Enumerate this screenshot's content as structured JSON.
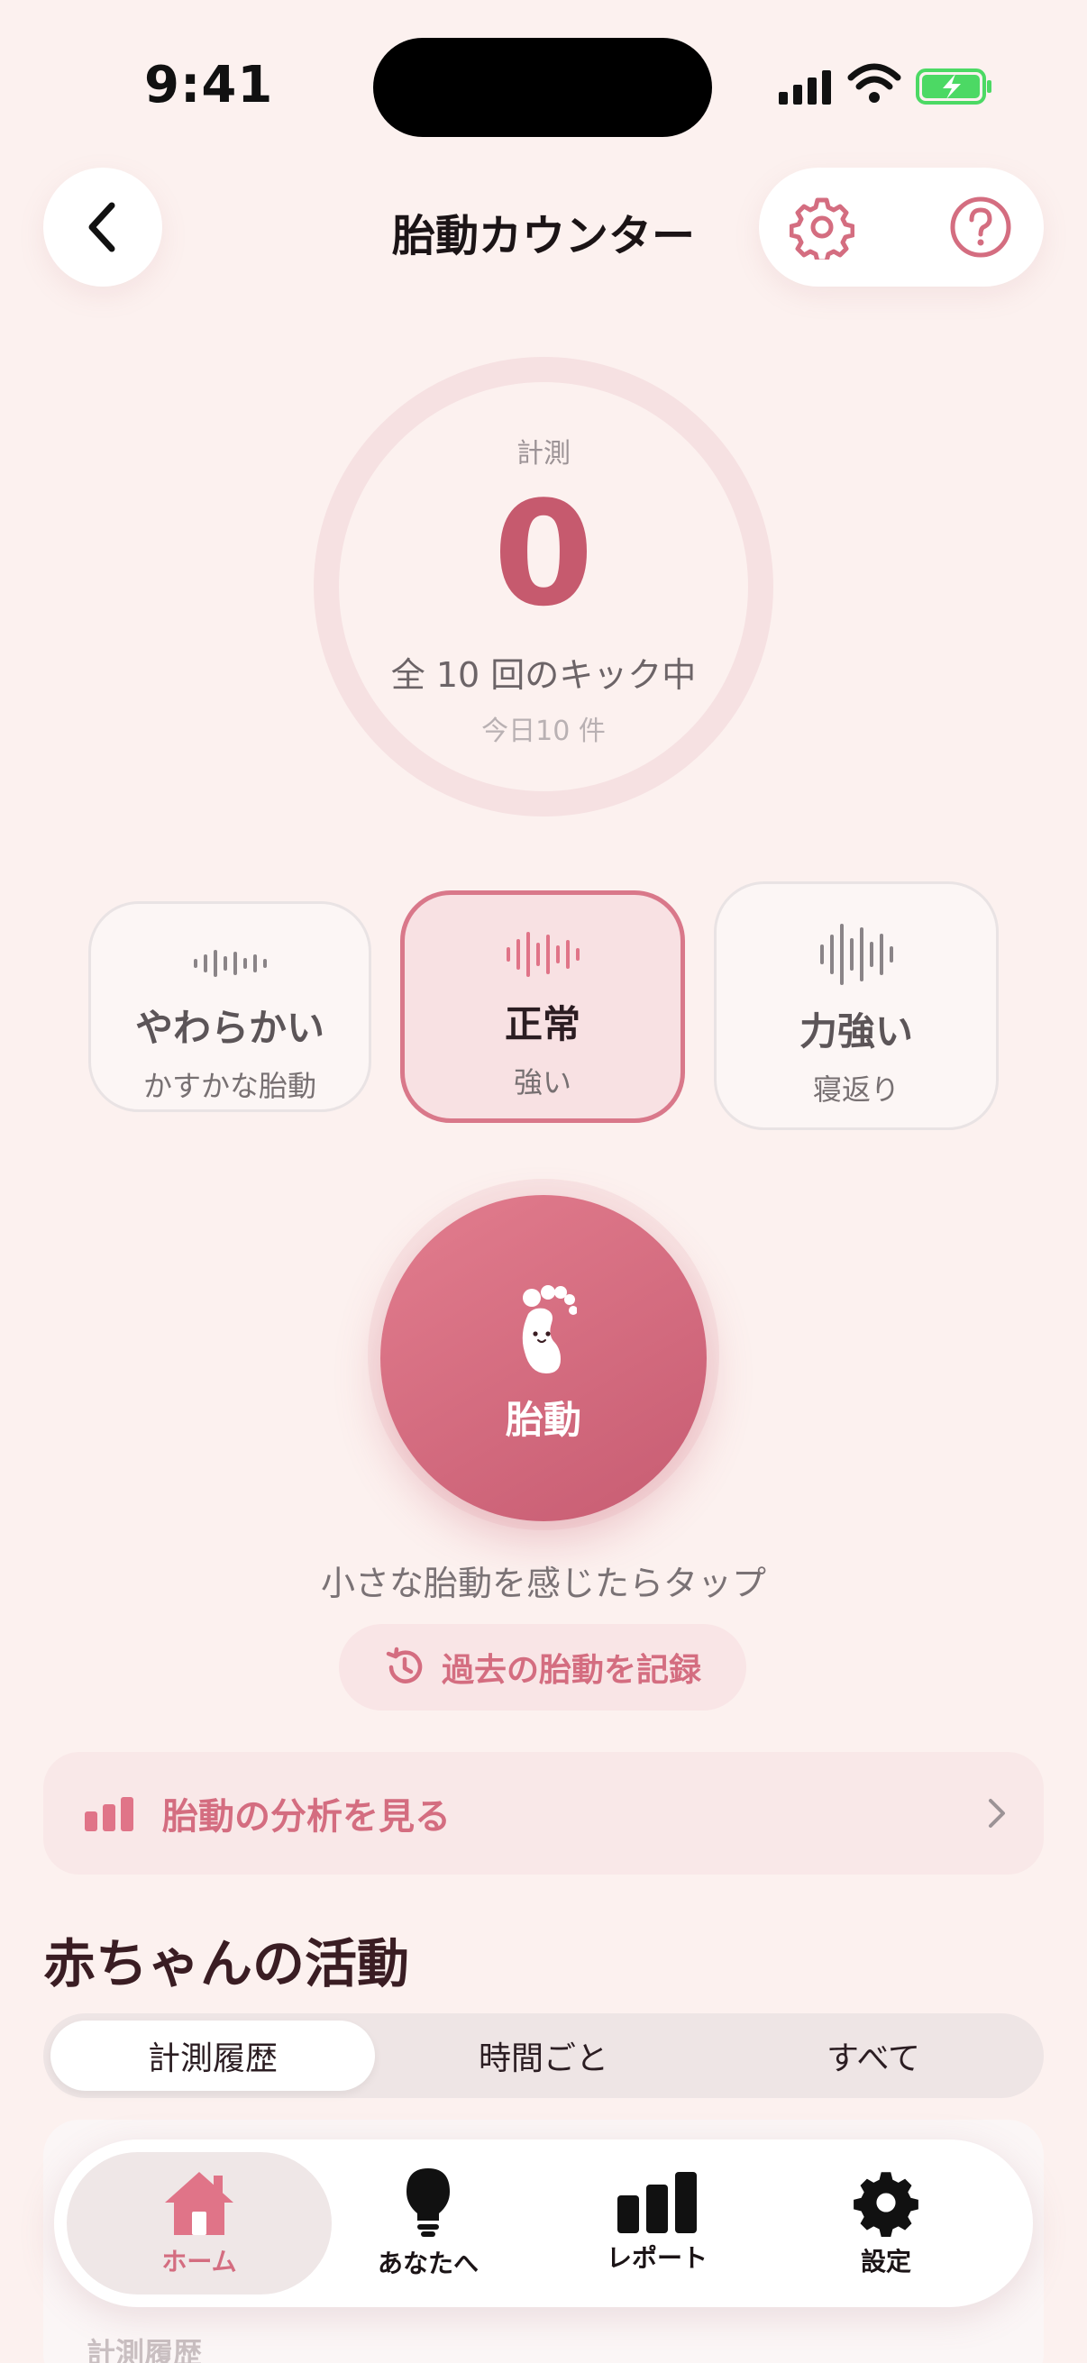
{
  "status_bar": {
    "time": "9:41"
  },
  "header": {
    "title": "胎動カウンター"
  },
  "counter": {
    "label": "計測",
    "count": "0",
    "subtitle": "全 10 回のキック中",
    "today": "今日10 件",
    "progress_fraction": 0
  },
  "intensity": [
    {
      "title": "やわらかい",
      "subtitle": "かすかな胎動",
      "selected": false
    },
    {
      "title": "正常",
      "subtitle": "強い",
      "selected": true
    },
    {
      "title": "力強い",
      "subtitle": "寝返り",
      "selected": false
    }
  ],
  "kick_button": {
    "label": "胎動"
  },
  "hint": "小さな胎動を感じたらタップ",
  "past_record_button": {
    "label": "過去の胎動を記録"
  },
  "analysis_link": {
    "label": "胎動の分析を見る"
  },
  "activity": {
    "title": "赤ちゃんの活動",
    "tabs": [
      "計測履歴",
      "時間ごと",
      "すべて"
    ],
    "active_tab": "計測履歴",
    "list_heading": "計測履歴"
  },
  "tabbar": {
    "items": [
      {
        "label": "ホーム",
        "icon": "house-icon",
        "active": true
      },
      {
        "label": "あなたへ",
        "icon": "lightbulb-icon",
        "active": false
      },
      {
        "label": "レポート",
        "icon": "bar-chart-icon",
        "active": false
      },
      {
        "label": "設定",
        "icon": "gear-icon",
        "active": false
      }
    ]
  },
  "colors": {
    "background": "#fcf1ef",
    "accent": "#d46d80",
    "accent_dark": "#c65a6e",
    "ring_track": "#f6e1e2",
    "battery_green": "#4cd964"
  }
}
